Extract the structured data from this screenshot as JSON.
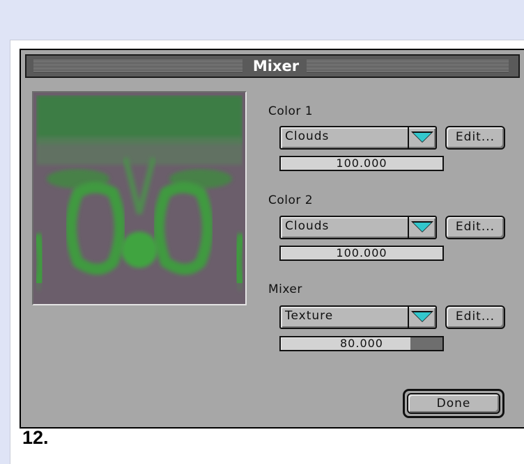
{
  "window": {
    "title": "Mixer"
  },
  "color1": {
    "label": "Color 1",
    "selected": "Clouds",
    "edit_label": "Edit...",
    "value_text": "100.000",
    "value_fraction": 1.0
  },
  "color2": {
    "label": "Color 2",
    "selected": "Clouds",
    "edit_label": "Edit...",
    "value_text": "100.000",
    "value_fraction": 1.0
  },
  "mixer": {
    "label": "Mixer",
    "selected": "Texture",
    "edit_label": "Edit...",
    "value_text": "80.000",
    "value_fraction": 0.8
  },
  "done_label": "Done",
  "step_label": "12.",
  "colors": {
    "preview_green": "#3f9a3f",
    "preview_purple": "#6b5e6b",
    "arrow": "#33c7cc"
  },
  "icons": {
    "dropdown_arrow": "triangle-down-icon"
  }
}
